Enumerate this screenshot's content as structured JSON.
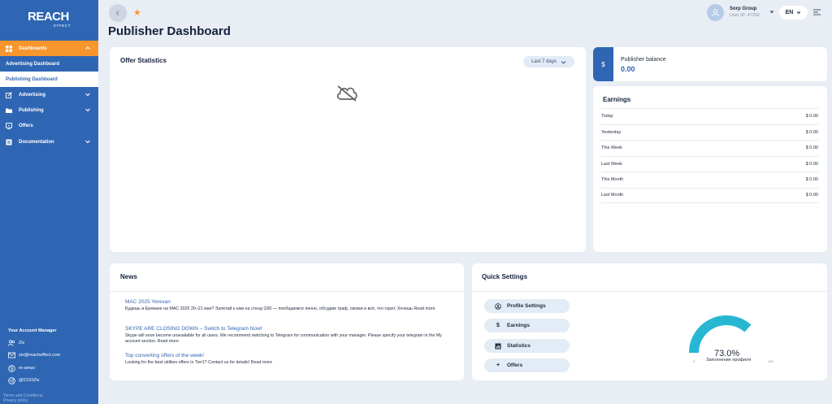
{
  "brand": {
    "logo_main": "REACH",
    "logo_sub": "EFFECT"
  },
  "sidebar": {
    "nav": [
      {
        "label": "Dashboards",
        "icon": "grid-icon",
        "expanded": true
      },
      {
        "label": "Advertising Dashboard"
      },
      {
        "label": "Publishing Dashboard"
      },
      {
        "label": "Advertising",
        "icon": "edit-icon"
      },
      {
        "label": "Publishing",
        "icon": "folder-icon"
      },
      {
        "label": "Offers",
        "icon": "monitor-icon"
      },
      {
        "label": "Documentation",
        "icon": "document-icon"
      }
    ],
    "manager": {
      "title": "Your Account Manager",
      "name": "Ziv",
      "email": "ziv@reacheffect.com",
      "skype": "re-amav",
      "telegram": "@COOZiv"
    },
    "terms": "Terms and Conditions",
    "privacy": "Privacy policy"
  },
  "header": {
    "page_title": "Publisher Dashboard",
    "user_name": "Sorp Group",
    "user_id": "User ID: 47292",
    "language": "EN"
  },
  "offer_stats": {
    "title": "Offer Statistics",
    "range": "Last 7 days"
  },
  "balance": {
    "symbol": "$",
    "label": "Publisher balance",
    "value": "0.00"
  },
  "earnings": {
    "title": "Earnings",
    "rows": [
      {
        "label": "Today",
        "value": "$ 0.00"
      },
      {
        "label": "Yesterday",
        "value": "$ 0.00"
      },
      {
        "label": "This Week",
        "value": "$ 0.00"
      },
      {
        "label": "Last Week",
        "value": "$ 0.00"
      },
      {
        "label": "This Month",
        "value": "$ 0.00"
      },
      {
        "label": "Last Month",
        "value": "$ 0.00"
      }
    ]
  },
  "news": {
    "title": "News",
    "items": [
      {
        "title": "MAC 2025 Yerevan",
        "body": "Будешь в Ереване на MAC 2025 20–21 мая? Залетай к нам на стенд G50 — пообщаемся лично, обсудим траф, связки и всё, что горит. Хочешь Read more"
      },
      {
        "title": "SKYPE ARE CLOSING DOWN – Switch to Telegram Now!",
        "body": "Skype will soon become unavailable for all users. We recommend switching to Telegram for communication with your manager. Please specify your telegram in the My account section. Read more"
      },
      {
        "title": "Top converting offers of the week!",
        "body": "Looking for the best utilities offers in Tier1? Contact us for details! Read more"
      }
    ]
  },
  "quick_settings": {
    "title": "Quick Settings",
    "buttons": [
      {
        "label": "Profile Settings",
        "icon": "user-icon"
      },
      {
        "label": "Earnings",
        "icon": "dollar-icon"
      },
      {
        "label": "Statistics",
        "icon": "chart-icon"
      },
      {
        "label": "Offers",
        "icon": "plus-icon"
      }
    ],
    "gauge": {
      "percent_text": "73.0%",
      "value": 0.73,
      "label": "Заполнение профиля",
      "min": "0",
      "max": "100",
      "color": "#27b7d3",
      "track_color": "#ffffff"
    }
  },
  "colors": {
    "sidebar": "#2f66b3",
    "accent": "#f7962c",
    "background": "#e9edf4"
  }
}
